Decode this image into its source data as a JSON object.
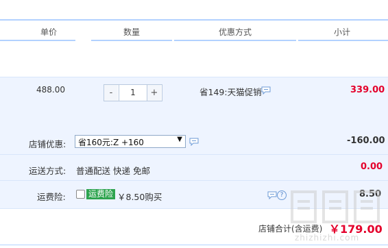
{
  "header": {
    "columns": [
      "单价",
      "数量",
      "优惠方式",
      "小计"
    ]
  },
  "item": {
    "unit_price": "488.00",
    "quantity": "1",
    "minus_label": "-",
    "plus_label": "+",
    "promotion": "省149:天猫促销",
    "subtotal": "339.00"
  },
  "shop_discount": {
    "label": "店铺优惠:",
    "selected_option": "省160元:Z +160",
    "amount": "-160.00"
  },
  "shipping": {
    "label": "运送方式:",
    "method": "普通配送 快递 免邮",
    "amount": "0.00"
  },
  "shipping_insurance": {
    "label": "运费险:",
    "badge": "运费险",
    "price_text": "￥8.50购买",
    "amount": "8.50"
  },
  "total": {
    "label": "店铺合计(含运费)",
    "amount": "￥179.00"
  },
  "watermark": {
    "text": "zhizhizhi.com"
  },
  "colors": {
    "accent_blue": "#b2d1ff",
    "row_bg": "#eef4ff",
    "price_red": "#e4002b",
    "badge_green": "#2ea44f"
  },
  "icons": [
    "chat-icon",
    "help-icon",
    "chevron-down-icon"
  ]
}
